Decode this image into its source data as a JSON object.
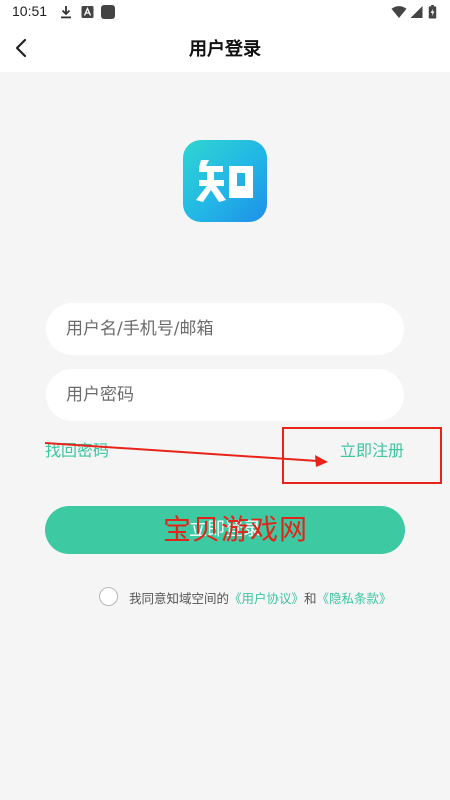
{
  "status_bar": {
    "time": "10:51",
    "icons_left": [
      "download-icon",
      "a-icon",
      "app-icon"
    ],
    "icons_right": [
      "wifi-icon",
      "signal-icon",
      "battery-icon"
    ]
  },
  "header": {
    "title": "用户登录",
    "back_icon": "back-arrow-icon"
  },
  "logo": {
    "icon": "zhi-logo-icon",
    "text": "知"
  },
  "form": {
    "username_placeholder": "用户名/手机号/邮箱",
    "password_placeholder": "用户密码",
    "forgot_password": "找回密码",
    "register": "立即注册",
    "login_button": "立即登录"
  },
  "agreement": {
    "checked": false,
    "prefix": "我同意知域空间的",
    "user_agreement": "《用户协议》",
    "conjunction": "和",
    "privacy_policy": "《隐私条款》"
  },
  "watermark": {
    "text": "宝贝游戏网"
  },
  "colors": {
    "accent": "#3dc9a1",
    "background": "#f5f5f5",
    "annotation_red": "#e8231a"
  }
}
